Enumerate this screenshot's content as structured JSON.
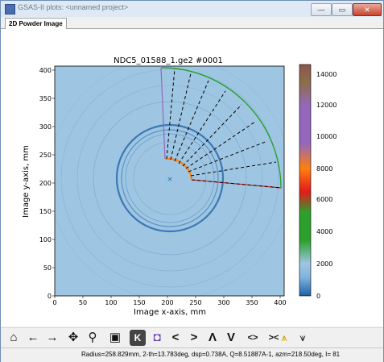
{
  "window": {
    "title": "GSAS-II plots: <unnamed project>",
    "controls": [
      "—",
      "▭",
      "✕"
    ]
  },
  "tabs": [
    "2D Powder Image"
  ],
  "plot": {
    "title": "NDC5_01588_1.ge2 #0001",
    "xlabel": "Image x-axis, mm",
    "ylabel": "Image y-axis, mm",
    "xticks": [
      "0",
      "50",
      "100",
      "150",
      "200",
      "250",
      "300",
      "350",
      "400"
    ],
    "yticks": [
      "0",
      "50",
      "100",
      "150",
      "200",
      "250",
      "300",
      "350",
      "400"
    ],
    "colorbar_ticks": [
      "0",
      "2000",
      "4000",
      "6000",
      "8000",
      "10000",
      "12000",
      "14000"
    ]
  },
  "toolbar": {
    "icons": [
      "home-icon",
      "back-icon",
      "forward-icon",
      "pan-icon",
      "zoom-icon",
      "save-icon",
      "k-icon",
      "palette-icon",
      "less-icon",
      "greater-icon",
      "caret-up-icon",
      "caret-down-icon",
      "spread-icon",
      "squeeze-icon",
      "arrows-icon"
    ],
    "glyphs": [
      "⌂",
      "←",
      "→",
      "✥",
      "⚲",
      "▣",
      "K",
      "◘",
      "<",
      ">",
      "Λ",
      "V",
      "<>",
      "><",
      "⩚"
    ]
  },
  "status": "Radius=258.829mm, 2-th=13.783deg, dsp=0.738A, Q=8.51887A-1, azm=218.50deg, I=    81",
  "colors": {
    "background_field": "#9ec6e2",
    "ring_dark": "#3e77b5",
    "green_arc": "#2ca02c",
    "red_edge": "#d62728",
    "purple_edge": "#9467bd",
    "orange_arc": "#ff7f0e",
    "beam_center": "#1f77b4"
  }
}
